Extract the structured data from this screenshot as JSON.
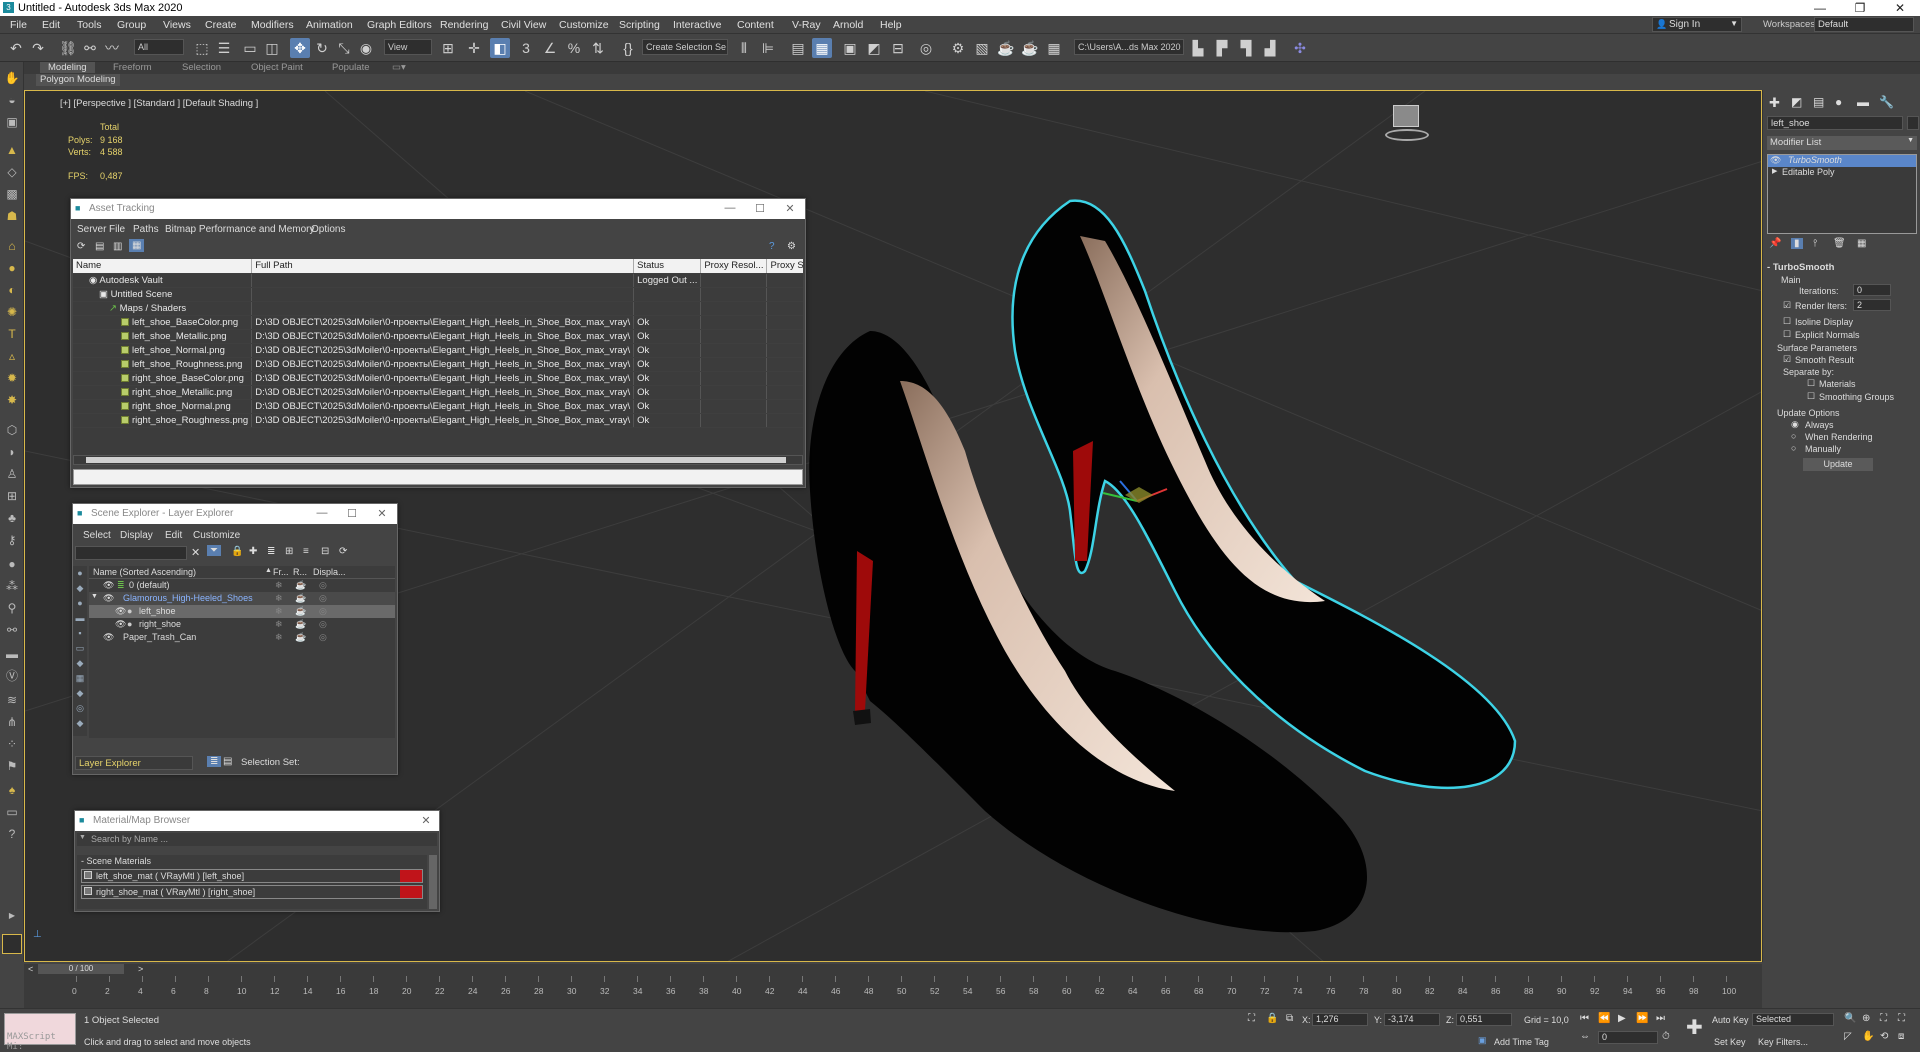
{
  "titlebar": {
    "title": "Untitled - Autodesk 3ds Max 2020",
    "min": "—",
    "max": "❐",
    "close": "✕"
  },
  "menu": [
    "File",
    "Edit",
    "Tools",
    "Group",
    "Views",
    "Create",
    "Modifiers",
    "Animation",
    "Graph Editors",
    "Rendering",
    "Civil View",
    "Customize",
    "Scripting",
    "Interactive",
    "Content",
    "V-Ray",
    "Arnold",
    "Help"
  ],
  "signin": {
    "label": "Sign In",
    "workspaces_label": "Workspaces:",
    "workspace": "Default"
  },
  "toolbar": {
    "filter": "All",
    "view": "View",
    "selection_set": "Create Selection Se",
    "path": "C:\\Users\\A...ds Max 2020"
  },
  "ribbon": {
    "tabs": [
      "Modeling",
      "Freeform",
      "Selection",
      "Object Paint",
      "Populate"
    ],
    "sub": "Polygon Modeling"
  },
  "viewport": {
    "label": "[+] [Perspective ] [Standard ] [Default Shading ]",
    "total": "Total",
    "polys_label": "Polys:",
    "polys": "9 168",
    "verts_label": "Verts:",
    "verts": "4 588",
    "fps_label": "FPS:",
    "fps": "0,487"
  },
  "asset_tracking": {
    "title": "Asset Tracking",
    "menus": [
      "Server",
      "File",
      "Paths",
      "Bitmap Performance and Memory",
      "Options"
    ],
    "columns": [
      "Name",
      "Full Path",
      "Status",
      "Proxy Resol...",
      "Proxy Status"
    ],
    "rows": [
      {
        "name": "Autodesk Vault",
        "path": "",
        "status": "Logged Out ..."
      },
      {
        "name": "Untitled Scene",
        "path": "",
        "status": ""
      },
      {
        "name": "Maps / Shaders",
        "path": "",
        "status": ""
      },
      {
        "name": "left_shoe_BaseColor.png",
        "path": "D:\\3D OBJECT\\2025\\3dMoiler\\0-проекты\\Elegant_High_Heels_in_Shoe_Box_max_vray\\",
        "status": "Ok"
      },
      {
        "name": "left_shoe_Metallic.png",
        "path": "D:\\3D OBJECT\\2025\\3dMoiler\\0-проекты\\Elegant_High_Heels_in_Shoe_Box_max_vray\\",
        "status": "Ok"
      },
      {
        "name": "left_shoe_Normal.png",
        "path": "D:\\3D OBJECT\\2025\\3dMoiler\\0-проекты\\Elegant_High_Heels_in_Shoe_Box_max_vray\\",
        "status": "Ok"
      },
      {
        "name": "left_shoe_Roughness.png",
        "path": "D:\\3D OBJECT\\2025\\3dMoiler\\0-проекты\\Elegant_High_Heels_in_Shoe_Box_max_vray\\",
        "status": "Ok"
      },
      {
        "name": "right_shoe_BaseColor.png",
        "path": "D:\\3D OBJECT\\2025\\3dMoiler\\0-проекты\\Elegant_High_Heels_in_Shoe_Box_max_vray\\",
        "status": "Ok"
      },
      {
        "name": "right_shoe_Metallic.png",
        "path": "D:\\3D OBJECT\\2025\\3dMoiler\\0-проекты\\Elegant_High_Heels_in_Shoe_Box_max_vray\\",
        "status": "Ok"
      },
      {
        "name": "right_shoe_Normal.png",
        "path": "D:\\3D OBJECT\\2025\\3dMoiler\\0-проекты\\Elegant_High_Heels_in_Shoe_Box_max_vray\\",
        "status": "Ok"
      },
      {
        "name": "right_shoe_Roughness.png",
        "path": "D:\\3D OBJECT\\2025\\3dMoiler\\0-проекты\\Elegant_High_Heels_in_Shoe_Box_max_vray\\",
        "status": "Ok"
      }
    ]
  },
  "scene_explorer": {
    "title": "Scene Explorer - Layer Explorer",
    "menus": [
      "Select",
      "Display",
      "Edit",
      "Customize"
    ],
    "columns": [
      "Name (Sorted Ascending)",
      "Fr...",
      "R...",
      "Displa..."
    ],
    "rows": [
      {
        "name": "0 (default)",
        "level": 1
      },
      {
        "name": "Glamorous_High-Heeled_Shoes",
        "level": 1
      },
      {
        "name": "left_shoe",
        "level": 2
      },
      {
        "name": "right_shoe",
        "level": 2
      },
      {
        "name": "Paper_Trash_Can",
        "level": 1
      }
    ],
    "footer_layer": "Layer Explorer",
    "selection_set_label": "Selection Set:"
  },
  "material_browser": {
    "title": "Material/Map Browser",
    "search_placeholder": "Search by Name ...",
    "group": "Scene Materials",
    "items": [
      "left_shoe_mat ( VRayMtl ) [left_shoe]",
      "right_shoe_mat ( VRayMtl ) [right_shoe]"
    ]
  },
  "command_panel": {
    "object_name": "left_shoe",
    "modifier_list": "Modifier List",
    "stack": [
      "TurboSmooth",
      "Editable Poly"
    ],
    "rollout": "TurboSmooth",
    "main": "Main",
    "iterations_label": "Iterations:",
    "iterations": "0",
    "render_iters_label": "Render Iters:",
    "render_iters": "2",
    "isoline": "Isoline Display",
    "explicit": "Explicit Normals",
    "surface": "Surface Parameters",
    "smooth_result": "Smooth Result",
    "separate": "Separate by:",
    "materials": "Materials",
    "smoothing_groups": "Smoothing Groups",
    "update_options": "Update Options",
    "always": "Always",
    "when_rendering": "When Rendering",
    "manually": "Manually",
    "update_btn": "Update"
  },
  "timeline": {
    "frame": "0 / 100",
    "ticks": [
      "0",
      "2",
      "4",
      "6",
      "8",
      "10",
      "12",
      "14",
      "16",
      "18",
      "20",
      "22",
      "24",
      "26",
      "28",
      "30",
      "32",
      "34",
      "36",
      "38",
      "40",
      "42",
      "44",
      "46",
      "48",
      "50",
      "52",
      "54",
      "56",
      "58",
      "60",
      "62",
      "64",
      "66",
      "68",
      "70",
      "72",
      "74",
      "76",
      "78",
      "80",
      "82",
      "84",
      "86",
      "88",
      "90",
      "92",
      "94",
      "96",
      "98",
      "100"
    ]
  },
  "status": {
    "maxscript": "MAXScript Mi:",
    "selected": "1 Object Selected",
    "hint": "Click and drag to select and move objects",
    "x_label": "X:",
    "x": "1,276",
    "y_label": "Y:",
    "y": "-3,174",
    "z_label": "Z:",
    "z": "0,551",
    "grid": "Grid = 10,0",
    "add_time_tag": "Add Time Tag",
    "auto_key": "Auto Key",
    "set_key": "Set Key",
    "selected_dd": "Selected",
    "key_filters": "Key Filters...",
    "frame_field": "0"
  }
}
